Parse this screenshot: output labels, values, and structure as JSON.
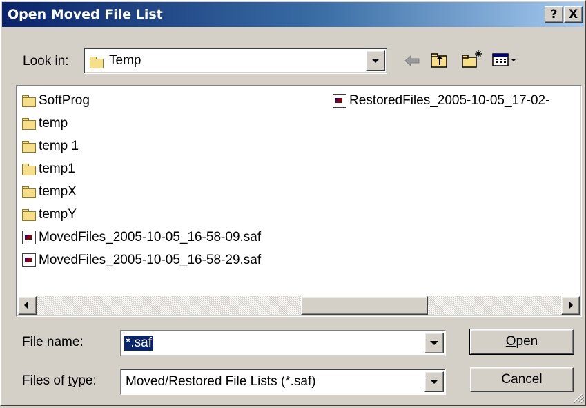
{
  "window": {
    "title": "Open Moved File List",
    "help_button": "?",
    "close_button": "X"
  },
  "lookin": {
    "label_pre": "Look ",
    "label_accel": "i",
    "label_post": "n:",
    "value": "Temp"
  },
  "toolbar": {
    "back_icon": "back-arrow-icon",
    "up_icon": "up-one-level-icon",
    "new_folder_icon": "new-folder-icon",
    "view_menu_icon": "view-menu-icon"
  },
  "files": {
    "column1": [
      {
        "name": "SoftProg",
        "type": "folder"
      },
      {
        "name": "temp",
        "type": "folder"
      },
      {
        "name": "temp 1",
        "type": "folder"
      },
      {
        "name": "temp1",
        "type": "folder"
      },
      {
        "name": "tempX",
        "type": "folder"
      },
      {
        "name": "tempY",
        "type": "folder"
      },
      {
        "name": "MovedFiles_2005-10-05_16-58-09.saf",
        "type": "saf"
      },
      {
        "name": "MovedFiles_2005-10-05_16-58-29.saf",
        "type": "saf"
      }
    ],
    "column2": [
      {
        "name": "RestoredFiles_2005-10-05_17-02-",
        "type": "saf"
      }
    ]
  },
  "filename": {
    "label_pre": "File ",
    "label_accel": "n",
    "label_post": "ame:",
    "value": "*.saf"
  },
  "filetype": {
    "label_pre": "Files of ",
    "label_accel": "t",
    "label_post": "ype:",
    "value": "Moved/Restored File Lists (*.saf)"
  },
  "buttons": {
    "open_accel": "O",
    "open_rest": "pen",
    "cancel": "Cancel"
  },
  "colors": {
    "title_start": "#0a246a",
    "title_end": "#a6caf0",
    "face": "#d4d0c8",
    "selection": "#0a246a"
  }
}
